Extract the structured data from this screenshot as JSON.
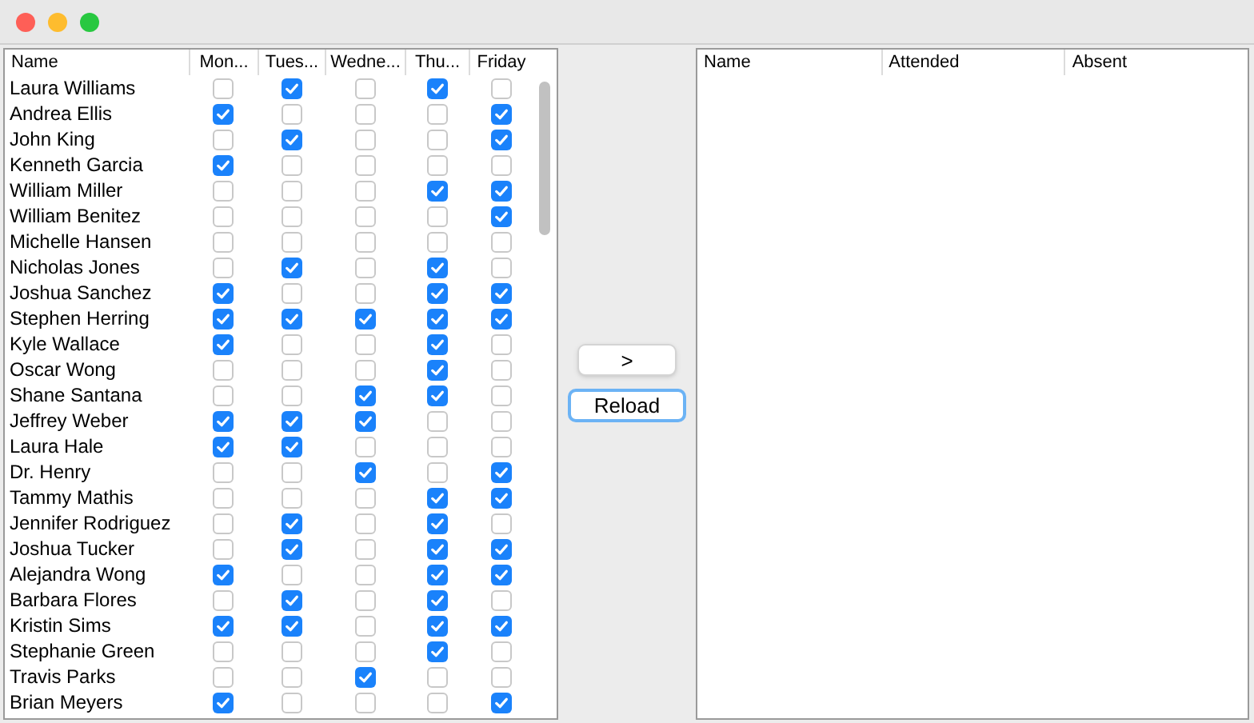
{
  "left_table": {
    "columns": [
      "Name",
      "Mon...",
      "Tues...",
      "Wedne...",
      "Thu...",
      "Friday"
    ],
    "rows": [
      {
        "name": "Laura Williams",
        "days": [
          false,
          true,
          false,
          true,
          false
        ]
      },
      {
        "name": "Andrea Ellis",
        "days": [
          true,
          false,
          false,
          false,
          true
        ]
      },
      {
        "name": "John King",
        "days": [
          false,
          true,
          false,
          false,
          true
        ]
      },
      {
        "name": "Kenneth Garcia",
        "days": [
          true,
          false,
          false,
          false,
          false
        ]
      },
      {
        "name": "William Miller",
        "days": [
          false,
          false,
          false,
          true,
          true
        ]
      },
      {
        "name": "William Benitez",
        "days": [
          false,
          false,
          false,
          false,
          true
        ]
      },
      {
        "name": "Michelle Hansen",
        "days": [
          false,
          false,
          false,
          false,
          false
        ]
      },
      {
        "name": "Nicholas Jones",
        "days": [
          false,
          true,
          false,
          true,
          false
        ]
      },
      {
        "name": "Joshua Sanchez",
        "days": [
          true,
          false,
          false,
          true,
          true
        ]
      },
      {
        "name": "Stephen Herring",
        "days": [
          true,
          true,
          true,
          true,
          true
        ]
      },
      {
        "name": "Kyle Wallace",
        "days": [
          true,
          false,
          false,
          true,
          false
        ]
      },
      {
        "name": "Oscar Wong",
        "days": [
          false,
          false,
          false,
          true,
          false
        ]
      },
      {
        "name": "Shane Santana",
        "days": [
          false,
          false,
          true,
          true,
          false
        ]
      },
      {
        "name": "Jeffrey Weber",
        "days": [
          true,
          true,
          true,
          false,
          false
        ]
      },
      {
        "name": "Laura Hale",
        "days": [
          true,
          true,
          false,
          false,
          false
        ]
      },
      {
        "name": "Dr. Henry",
        "days": [
          false,
          false,
          true,
          false,
          true
        ]
      },
      {
        "name": "Tammy Mathis",
        "days": [
          false,
          false,
          false,
          true,
          true
        ]
      },
      {
        "name": "Jennifer Rodriguez",
        "days": [
          false,
          true,
          false,
          true,
          false
        ]
      },
      {
        "name": "Joshua Tucker",
        "days": [
          false,
          true,
          false,
          true,
          true
        ]
      },
      {
        "name": "Alejandra Wong",
        "days": [
          true,
          false,
          false,
          true,
          true
        ]
      },
      {
        "name": "Barbara Flores",
        "days": [
          false,
          true,
          false,
          true,
          false
        ]
      },
      {
        "name": "Kristin Sims",
        "days": [
          true,
          true,
          false,
          true,
          true
        ]
      },
      {
        "name": "Stephanie Green",
        "days": [
          false,
          false,
          false,
          true,
          false
        ]
      },
      {
        "name": "Travis Parks",
        "days": [
          false,
          false,
          true,
          false,
          false
        ]
      },
      {
        "name": "Brian Meyers",
        "days": [
          true,
          false,
          false,
          false,
          true
        ]
      }
    ]
  },
  "buttons": [
    {
      "label": ">",
      "focused": false
    },
    {
      "label": "Reload",
      "focused": true
    }
  ],
  "right_table": {
    "columns": [
      "Name",
      "Attended",
      "Absent"
    ]
  }
}
